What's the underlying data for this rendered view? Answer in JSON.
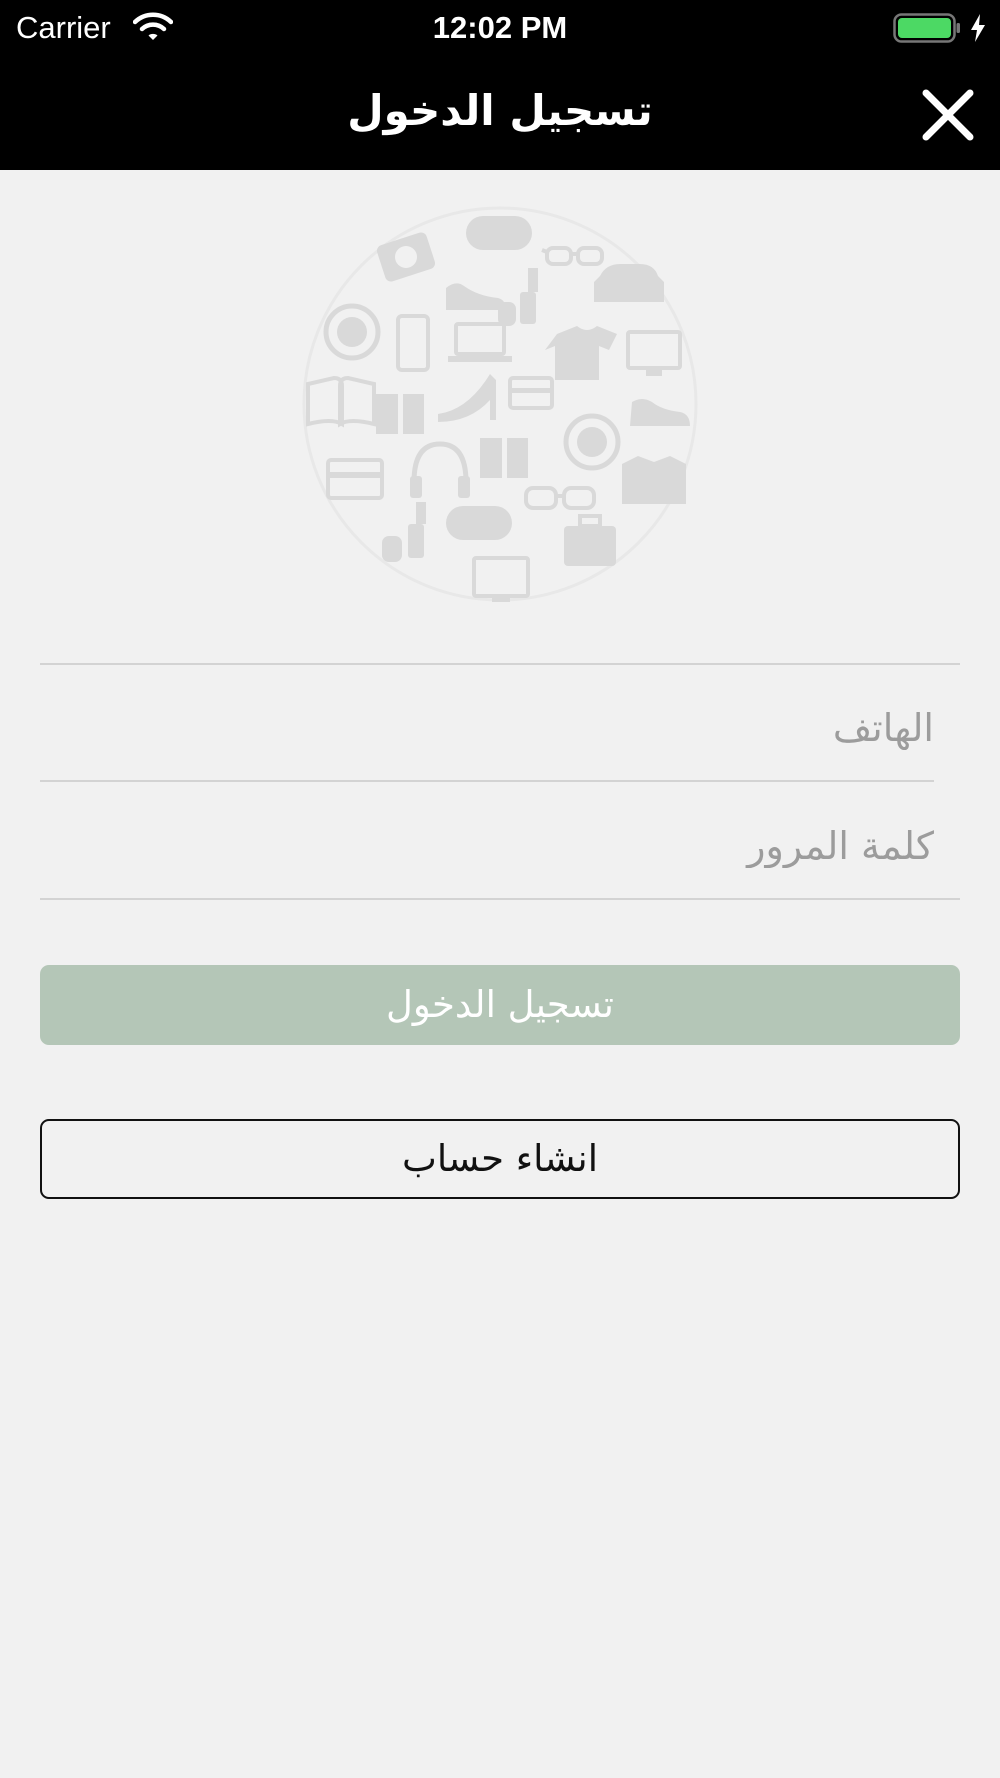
{
  "status_bar": {
    "carrier": "Carrier",
    "time": "12:02 PM",
    "wifi_icon": "wifi-icon",
    "battery_icon": "battery-full-icon",
    "charging_icon": "charging-bolt-icon",
    "battery_color": "#4cd964"
  },
  "nav_bar": {
    "title": "تسجيل الدخول",
    "close_icon": "close-icon",
    "background": "#000000"
  },
  "logo": {
    "icon": "shopping-categories-circle-icon"
  },
  "form": {
    "phone_placeholder": "الهاتف",
    "phone_value": "",
    "password_placeholder": "كلمة المرور",
    "password_value": ""
  },
  "buttons": {
    "login_label": "تسجيل الدخول",
    "login_color": "#b4c6b7",
    "signup_label": "انشاء حساب"
  }
}
